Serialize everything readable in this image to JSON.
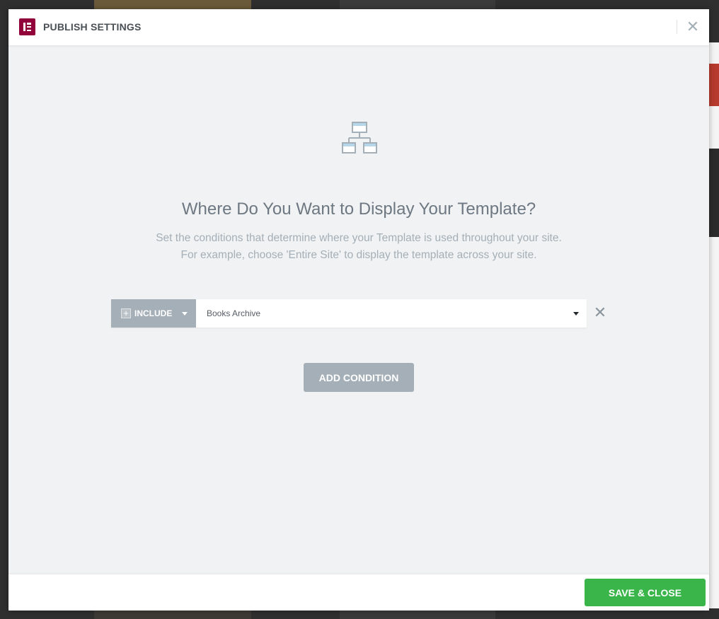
{
  "modal": {
    "title": "PUBLISH SETTINGS",
    "close_icon": "close-icon",
    "heading": "Where Do You Want to Display Your Template?",
    "description_line1": "Set the conditions that determine where your Template is used throughout your site.",
    "description_line2": "For example, choose 'Entire Site' to display the template across your site."
  },
  "conditions": [
    {
      "type_label": "INCLUDE",
      "type_icon": "plus-icon",
      "value": "Books Archive"
    }
  ],
  "actions": {
    "add_condition_label": "ADD CONDITION",
    "save_close_label": "SAVE & CLOSE"
  },
  "colors": {
    "brand": "#92003b",
    "save_button": "#39b54a",
    "muted_button": "#a4afb7",
    "background": "#f1f2f3"
  }
}
